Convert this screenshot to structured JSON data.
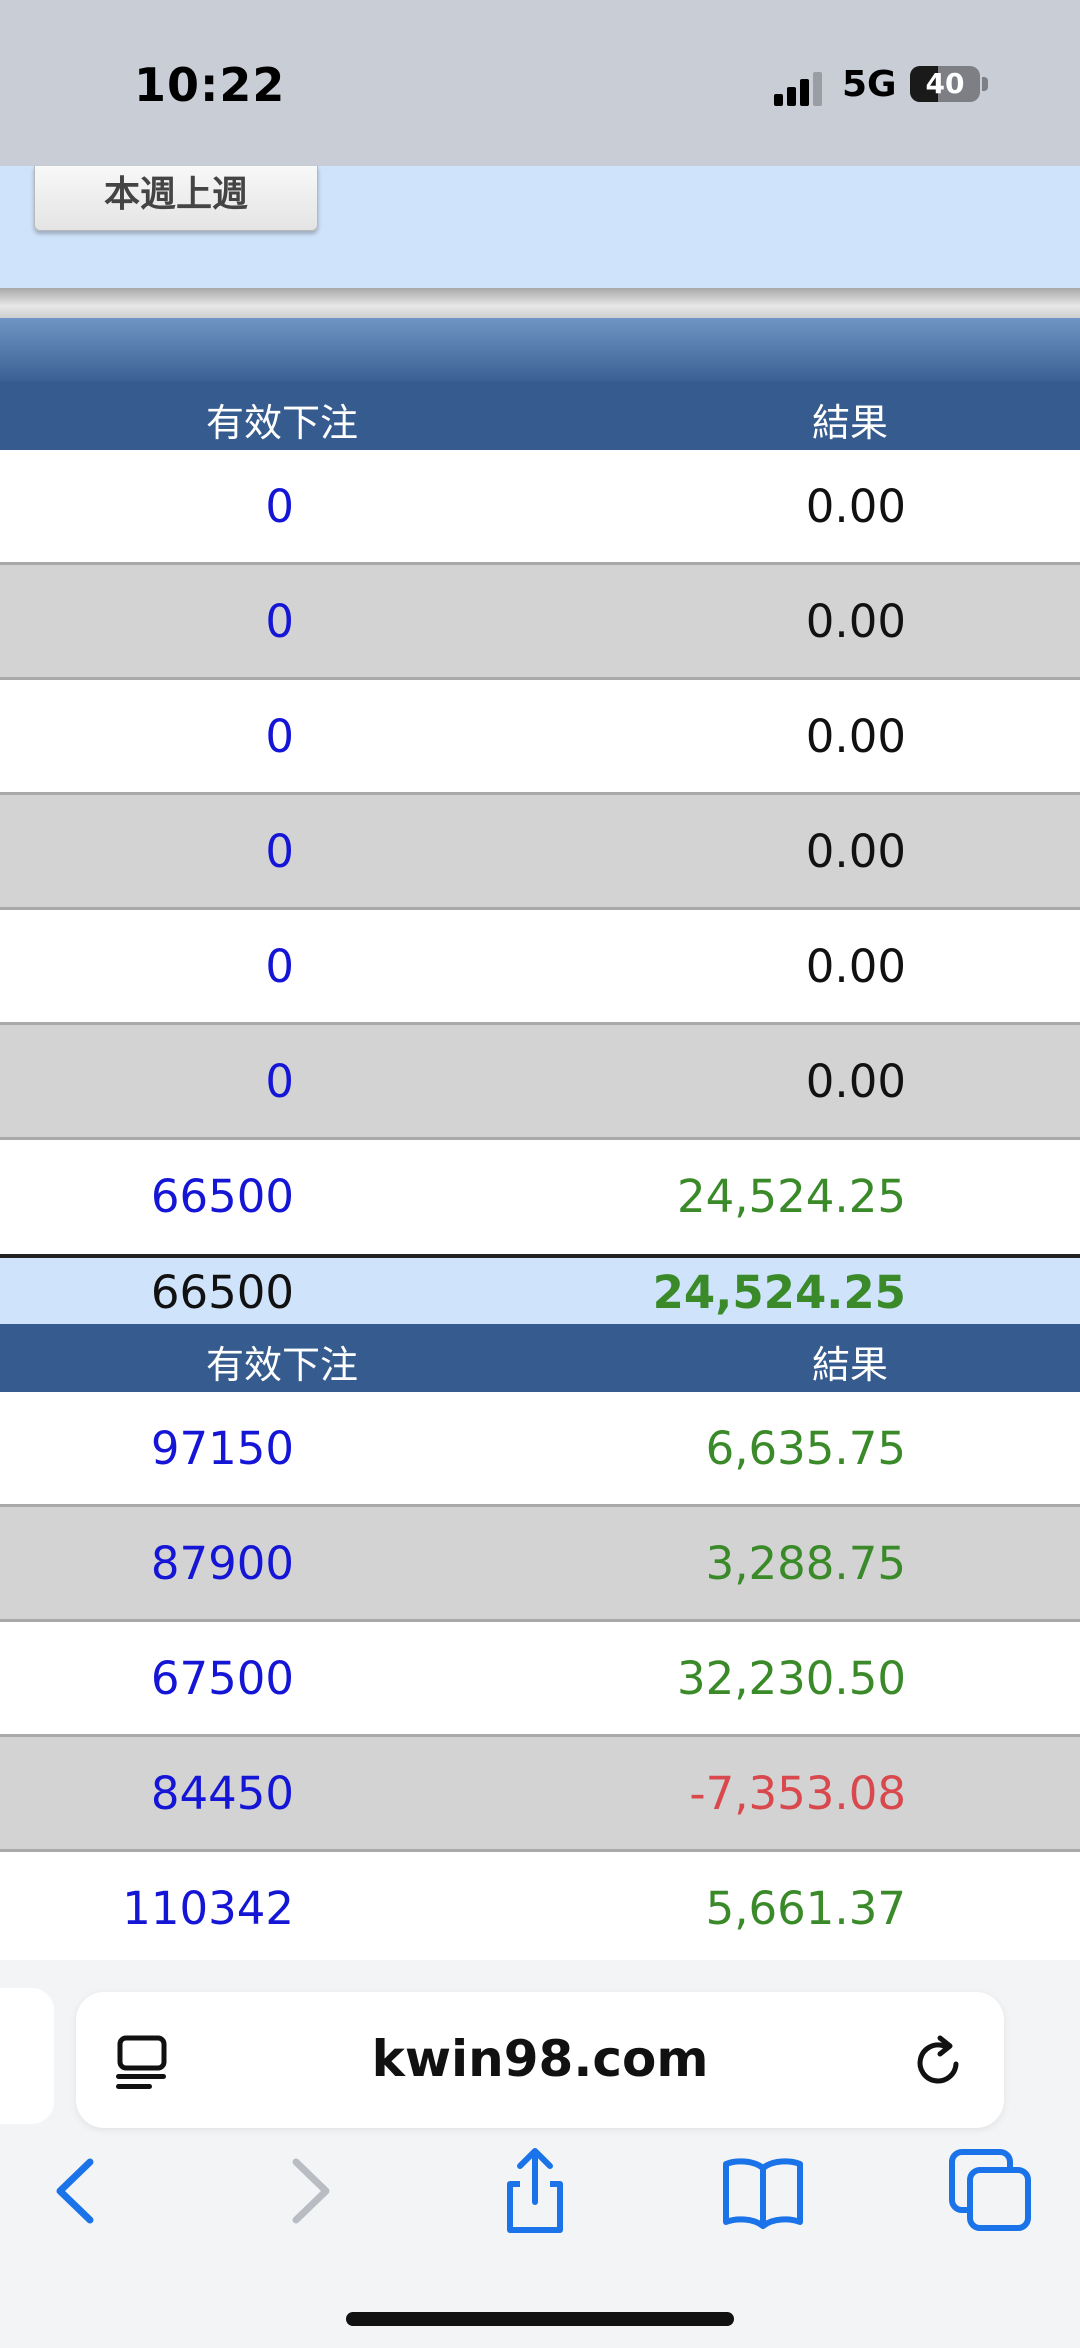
{
  "status_bar": {
    "time": "10:22",
    "network": "5G",
    "battery": "40",
    "battery_level": 0.4
  },
  "week_button": "本週上週",
  "table1": {
    "headers": {
      "bet": "有效下注",
      "result": "結果"
    },
    "rows": [
      {
        "bet": "0",
        "result": "0.00"
      },
      {
        "bet": "0",
        "result": "0.00"
      },
      {
        "bet": "0",
        "result": "0.00"
      },
      {
        "bet": "0",
        "result": "0.00"
      },
      {
        "bet": "0",
        "result": "0.00"
      },
      {
        "bet": "0",
        "result": "0.00"
      },
      {
        "bet": "66500",
        "result": "24,524.25"
      }
    ]
  },
  "total": {
    "bet": "66500",
    "result": "24,524.25"
  },
  "table2": {
    "headers": {
      "bet": "有效下注",
      "result": "結果"
    },
    "rows": [
      {
        "bet": "97150",
        "result": "6,635.75"
      },
      {
        "bet": "87900",
        "result": "3,288.75"
      },
      {
        "bet": "67500",
        "result": "32,230.50"
      },
      {
        "bet": "84450",
        "result": "-7,353.08"
      },
      {
        "bet": "110342",
        "result": "5,661.37"
      }
    ]
  },
  "browser": {
    "url": "kwin98.com"
  },
  "colors": {
    "positive": "#3a8a2a",
    "negative": "#d9484d",
    "bet_blue": "#1515d6",
    "header_blue": "#365b8f"
  }
}
